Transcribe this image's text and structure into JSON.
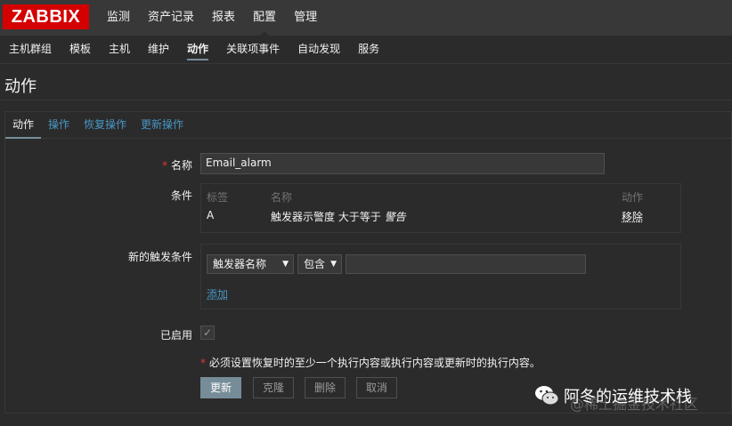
{
  "brand": {
    "logo": "ZABBIX",
    "color": "#d40000"
  },
  "top_nav": [
    {
      "label": "监测",
      "active": false
    },
    {
      "label": "资产记录",
      "active": false
    },
    {
      "label": "报表",
      "active": false
    },
    {
      "label": "配置",
      "active": true
    },
    {
      "label": "管理",
      "active": false
    }
  ],
  "sub_nav": [
    {
      "label": "主机群组",
      "active": false
    },
    {
      "label": "模板",
      "active": false
    },
    {
      "label": "主机",
      "active": false
    },
    {
      "label": "维护",
      "active": false
    },
    {
      "label": "动作",
      "active": true
    },
    {
      "label": "关联项事件",
      "active": false
    },
    {
      "label": "自动发现",
      "active": false
    },
    {
      "label": "服务",
      "active": false
    }
  ],
  "page_title": "动作",
  "tabs": [
    {
      "label": "动作",
      "active": true
    },
    {
      "label": "操作",
      "active": false
    },
    {
      "label": "恢复操作",
      "active": false
    },
    {
      "label": "更新操作",
      "active": false
    }
  ],
  "form": {
    "name_label": "名称",
    "required_mark": "*",
    "name_value": "Email_alarm",
    "conditions_label": "条件",
    "conditions_headers": {
      "tag": "标签",
      "name": "名称",
      "action": "动作"
    },
    "conditions": [
      {
        "tag": "A",
        "text": "触发器示警度 大于等于",
        "value": "警告",
        "action": "移除"
      }
    ],
    "new_condition_label": "新的触发条件",
    "new_condition": {
      "type_select": "触发器名称",
      "operator_select": "包含",
      "value": "",
      "add_link": "添加"
    },
    "enabled_label": "已启用",
    "enabled": true,
    "note": "必须设置恢复时的至少一个执行内容或执行内容或更新时的执行内容。",
    "buttons": {
      "update": "更新",
      "clone": "克隆",
      "delete": "删除",
      "cancel": "取消"
    }
  },
  "watermark": {
    "name": "阿冬的运维技术栈",
    "sub": "@稀土掘金技术社区"
  },
  "colors": {
    "link": "#4796c4",
    "background": "#2b2b2b",
    "bar": "#383838",
    "primary_button": "#768d99"
  }
}
